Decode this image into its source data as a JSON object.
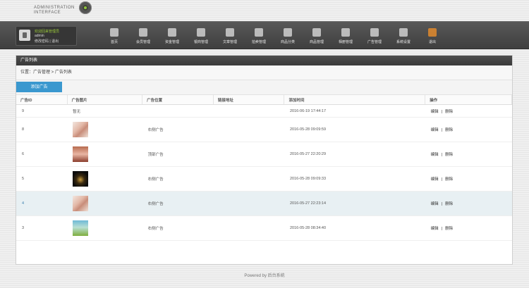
{
  "brand": {
    "line1": "ADMINISTRATION",
    "line2": "INTERFACE"
  },
  "user": {
    "welcome": "欢迎回来管理员",
    "name": "admin",
    "links": "修改密码 | 退出"
  },
  "nav": [
    "首页",
    "会员管理",
    "资金管理",
    "银商管理",
    "文章管理",
    "拍卖管理",
    "商品分类",
    "商品管理",
    "相册管理",
    "广告管理",
    "系统设置",
    "退出"
  ],
  "panel": {
    "title": "广告列表",
    "breadcrumb": "位置：广告管理 > 广告列表",
    "add_label": "添加广告",
    "columns": [
      "广告ID",
      "广告图片",
      "广告位置",
      "链接地址",
      "添加时间",
      "操作"
    ],
    "rows": [
      {
        "id": "9",
        "image": "暂无",
        "position": "",
        "link": "",
        "time": "2016-06-19 17:44:17",
        "thumb": "none"
      },
      {
        "id": "8",
        "image": "",
        "position": "右侧广告",
        "link": "",
        "time": "2016-05-28 09:09:59",
        "thumb": "flowers"
      },
      {
        "id": "6",
        "image": "",
        "position": "顶部广告",
        "link": "",
        "time": "2016-05-27 22:20:29",
        "thumb": "hall"
      },
      {
        "id": "5",
        "image": "",
        "position": "右侧广告",
        "link": "",
        "time": "2016-05-28 09:09:33",
        "thumb": "dark"
      },
      {
        "id": "4",
        "image": "",
        "position": "右侧广告",
        "link": "",
        "time": "2016-05-27 22:23:14",
        "thumb": "flowers"
      },
      {
        "id": "3",
        "image": "",
        "position": "右侧广告",
        "link": "",
        "time": "2016-05-28 08:34:40",
        "thumb": "sky"
      }
    ],
    "edit_label": "编辑",
    "delete_label": "删除"
  },
  "footer": "Powered by 后台系统"
}
